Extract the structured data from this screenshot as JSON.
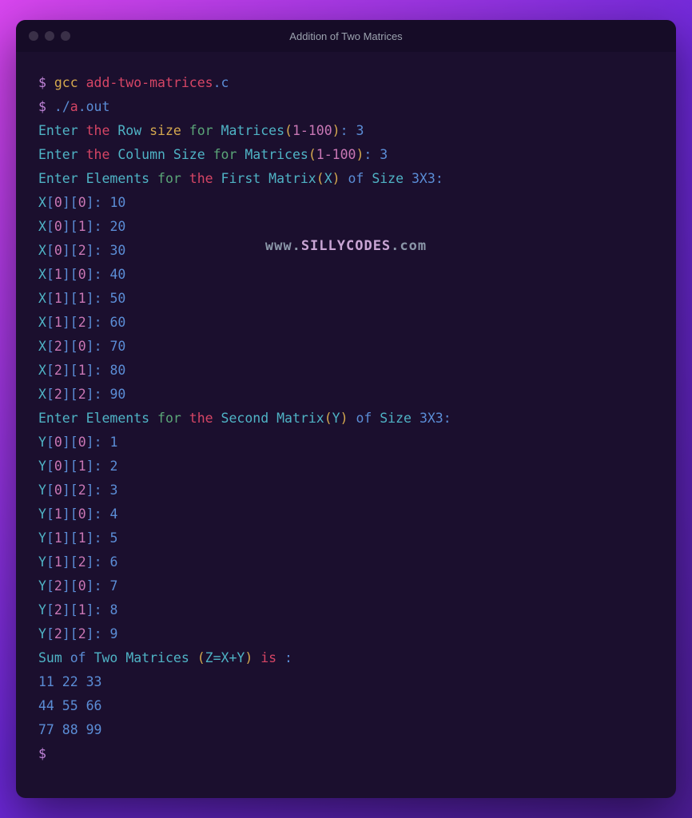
{
  "window": {
    "title": "Addition of Two Matrices"
  },
  "watermark": {
    "prefix": "www.",
    "main": "SILLYCODES",
    "suffix": ".com"
  },
  "prompt": "$",
  "commands": {
    "compile": {
      "gcc": "gcc",
      "file": "add-two-matrices",
      "ext": ".c"
    },
    "run": {
      "dot": ".",
      "slash": "/",
      "a": "a",
      "out": ".out"
    }
  },
  "prompts": {
    "row": {
      "enter": "Enter",
      "the": "the",
      "row": "Row",
      "size": "size",
      "for": "for",
      "matrices": "Matrices",
      "range": "1-100",
      "colon": ":",
      "val": "3"
    },
    "col": {
      "enter": "Enter",
      "the": "the",
      "column": "Column",
      "size_cap": "Size",
      "for": "for",
      "matrices": "Matrices",
      "range": "1-100",
      "colon": ":",
      "val": "3"
    },
    "firstMatrix": {
      "enter": "Enter",
      "elements": "Elements",
      "for": "for",
      "the": "the",
      "first": "First",
      "matrix": "Matrix",
      "var": "X",
      "of": "of",
      "size_cap": "Size",
      "dims": "3X3",
      "colon": ":"
    },
    "secondMatrix": {
      "enter": "Enter",
      "elements": "Elements",
      "for": "for",
      "the": "the",
      "second": "Second",
      "matrix": "Matrix",
      "var": "Y",
      "of": "of",
      "size_cap": "Size",
      "dims": "3X3",
      "colon": ":"
    }
  },
  "x_inputs": [
    {
      "var": "X",
      "i": "0",
      "j": "0",
      "val": "10"
    },
    {
      "var": "X",
      "i": "0",
      "j": "1",
      "val": "20"
    },
    {
      "var": "X",
      "i": "0",
      "j": "2",
      "val": "30"
    },
    {
      "var": "X",
      "i": "1",
      "j": "0",
      "val": "40"
    },
    {
      "var": "X",
      "i": "1",
      "j": "1",
      "val": "50"
    },
    {
      "var": "X",
      "i": "1",
      "j": "2",
      "val": "60"
    },
    {
      "var": "X",
      "i": "2",
      "j": "0",
      "val": "70"
    },
    {
      "var": "X",
      "i": "2",
      "j": "1",
      "val": "80"
    },
    {
      "var": "X",
      "i": "2",
      "j": "2",
      "val": "90"
    }
  ],
  "y_inputs": [
    {
      "var": "Y",
      "i": "0",
      "j": "0",
      "val": "1"
    },
    {
      "var": "Y",
      "i": "0",
      "j": "1",
      "val": "2"
    },
    {
      "var": "Y",
      "i": "0",
      "j": "2",
      "val": "3"
    },
    {
      "var": "Y",
      "i": "1",
      "j": "0",
      "val": "4"
    },
    {
      "var": "Y",
      "i": "1",
      "j": "1",
      "val": "5"
    },
    {
      "var": "Y",
      "i": "1",
      "j": "2",
      "val": "6"
    },
    {
      "var": "Y",
      "i": "2",
      "j": "0",
      "val": "7"
    },
    {
      "var": "Y",
      "i": "2",
      "j": "1",
      "val": "8"
    },
    {
      "var": "Y",
      "i": "2",
      "j": "2",
      "val": "9"
    }
  ],
  "sum": {
    "sum": "Sum",
    "of": "of",
    "two": "Two",
    "matrices": "Matrices",
    "expr": "Z=X+Y",
    "is": "is",
    "colon": ":"
  },
  "result_rows": [
    "11 22 33",
    "44 55 66",
    "77 88 99"
  ]
}
